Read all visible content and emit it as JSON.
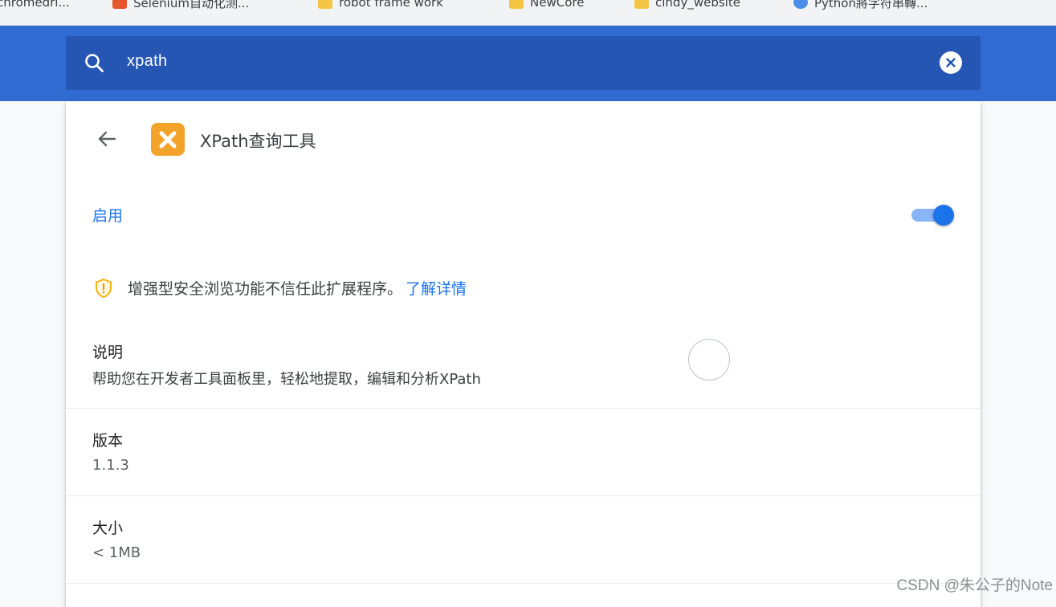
{
  "bookmarks": [
    {
      "label": "chromedri...",
      "icon": "none"
    },
    {
      "label": "Selenium自动化测...",
      "icon": "site-favicon"
    },
    {
      "label": "robot frame work",
      "icon": "folder-icon"
    },
    {
      "label": "NewCore",
      "icon": "folder-icon"
    },
    {
      "label": "cindy_website",
      "icon": "folder-icon"
    },
    {
      "label": "Python將字符串轉...",
      "icon": "site-favicon"
    }
  ],
  "search": {
    "value": "xpath",
    "icon": "search-icon",
    "clear_icon": "clear-icon"
  },
  "extension": {
    "name": "XPath查询工具",
    "icon_letter": "X",
    "icon_color": "#f4a32a"
  },
  "enable": {
    "label": "启用",
    "on": true
  },
  "warning": {
    "text": "增强型安全浏览功能不信任此扩展程序。",
    "link": "了解详情"
  },
  "details": {
    "description_title": "说明",
    "description_value": "帮助您在开发者工具面板里，轻松地提取，编辑和分析XPath",
    "version_title": "版本",
    "version_value": "1.1.3",
    "size_title": "大小",
    "size_value": "< 1MB"
  },
  "watermark": "CSDN @朱公子的Note",
  "colors": {
    "header": "#2f6bd1",
    "search_bg": "#2556b3",
    "accent": "#1a73e8"
  }
}
